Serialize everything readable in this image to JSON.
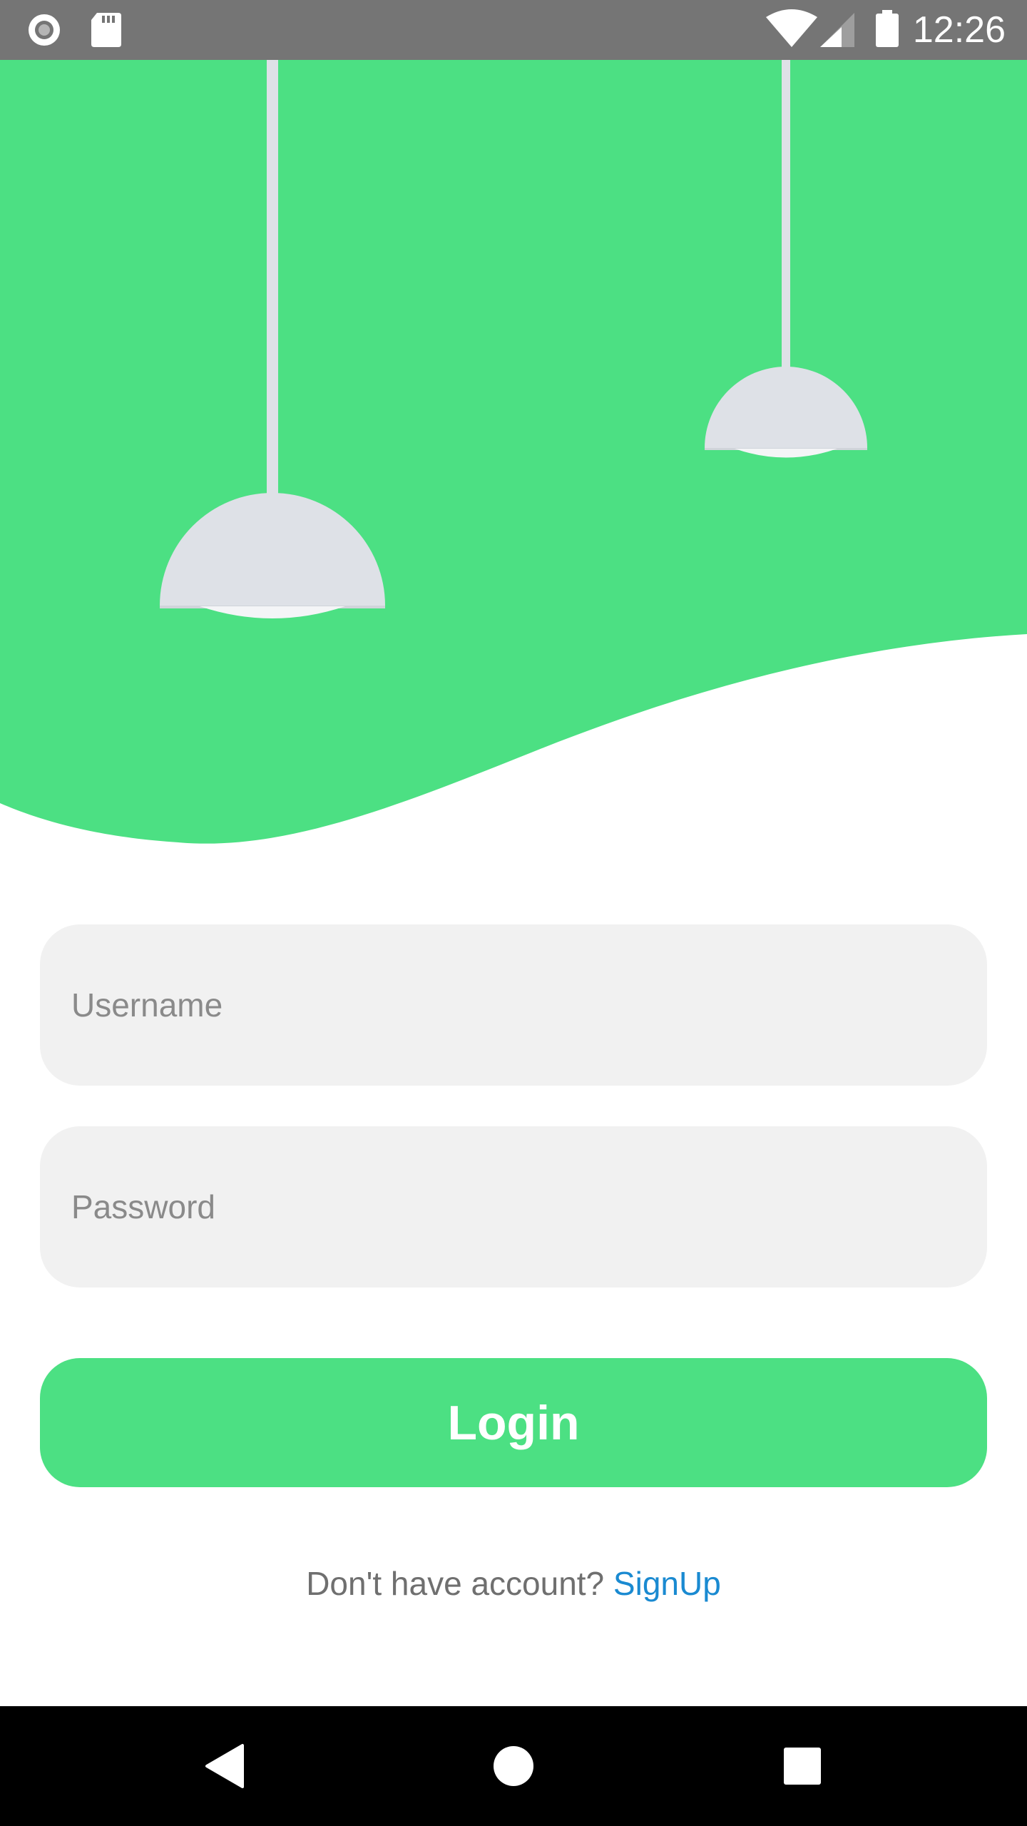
{
  "status_bar": {
    "time": "12:26",
    "left_icons": [
      "record-icon",
      "sd-card-icon"
    ],
    "right_icons": [
      "wifi-icon",
      "cellular-signal-icon",
      "battery-icon"
    ]
  },
  "colors": {
    "accent": "#4CE083",
    "lamp": "#DEE1E7",
    "field_bg": "#F1F1F1",
    "link": "#1A8AD1",
    "status_bar": "#757575"
  },
  "hero": {
    "illustration": [
      "pendant-lamp-left",
      "pendant-lamp-right",
      "wave-shape"
    ]
  },
  "form": {
    "username_placeholder": "Username",
    "username_value": "",
    "password_placeholder": "Password",
    "password_value": "",
    "login_label": "Login"
  },
  "signup": {
    "prompt": "Don't have account? ",
    "link_label": "SignUp"
  },
  "nav_bar": {
    "buttons": [
      "back-icon",
      "home-icon",
      "recents-icon"
    ]
  }
}
